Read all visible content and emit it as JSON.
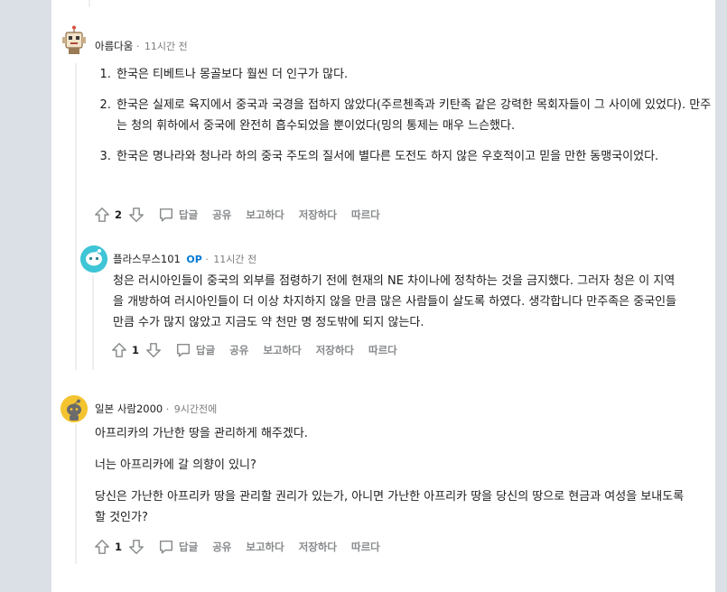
{
  "comments": [
    {
      "author": "아름다움",
      "time": "11시간 전",
      "items": [
        "한국은 티베트나 몽골보다 훨씬 더 인구가 많다.",
        "한국은 실제로 육지에서 중국과 국경을 접하지 않았다(주르첸족과 키탄족 같은 강력한 목회자들이 그 사이에 있었다). 만주는 청의 휘하에서 중국에 완전히 흡수되었을 뿐이었다(밍의 통제는 매우 느슨했다.",
        "한국은 명나라와 청나라 하의 중국 주도의 질서에 별다른 도전도 하지 않은 우호적이고 믿을 만한 동맹국이었다."
      ],
      "votes": "2"
    },
    {
      "author": "플라스무스101",
      "op_badge": "OP",
      "time": "11시간 전",
      "text": "청은 러시아인들이 중국의 외부를 점령하기 전에 현재의 NE 차이나에 정착하는 것을 금지했다. 그러자 청은 이 지역을 개방하여 러시아인들이 더 이상 차지하지 않을 만큼 많은 사람들이 살도록 하였다. 생각합니다 만주족은 중국인들만큼 수가 많지 않았고 지금도 약 천만 명 정도밖에 되지 않는다.",
      "votes": "1"
    },
    {
      "author": "일본 사람2000",
      "time": "9시간전에",
      "paragraphs": [
        "아프리카의 가난한 땅을 관리하게 해주겠다.",
        "너는 아프리카에 갈 의향이 있니?",
        "당신은 가난한 아프리카 땅을 관리할 권리가 있는가, 아니면 가난한 아프리카 땅을 당신의 땅으로 현금과 여성을 보내도록 할 것인가?"
      ],
      "votes": "1"
    }
  ],
  "actions": {
    "reply": "답글",
    "share": "공유",
    "report": "보고하다",
    "save": "저장하다",
    "follow": "따르다"
  },
  "meta_separator": "·",
  "icons": {
    "upvote": "upvote-arrow-icon",
    "downvote": "downvote-arrow-icon",
    "reply": "speech-bubble-icon"
  },
  "colors": {
    "page_bg": "#dae0e6",
    "panel_bg": "#ffffff",
    "op_blue": "#0079d3",
    "muted": "#878a8c"
  }
}
